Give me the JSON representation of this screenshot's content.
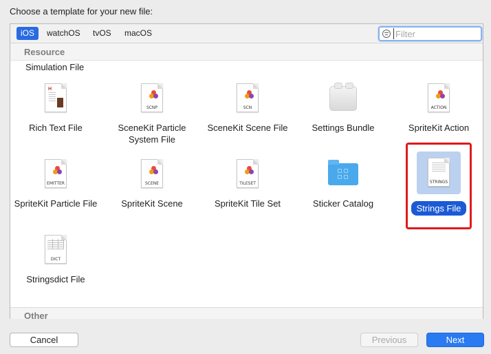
{
  "dialog": {
    "heading": "Choose a template for your new file:"
  },
  "platform_tabs": [
    {
      "label": "iOS",
      "selected": true
    },
    {
      "label": "watchOS",
      "selected": false
    },
    {
      "label": "tvOS",
      "selected": false
    },
    {
      "label": "macOS",
      "selected": false
    }
  ],
  "filter": {
    "placeholder": "Filter",
    "value": ""
  },
  "sections": {
    "resource": "Resource",
    "other": "Other"
  },
  "partial_item": "Simulation File",
  "templates": [
    {
      "label": "Rich Text File",
      "icon": "rich-text-file-icon",
      "caption": ""
    },
    {
      "label": "SceneKit Particle System File",
      "icon": "scenekit-particle-icon",
      "caption": "SCNP"
    },
    {
      "label": "SceneKit Scene File",
      "icon": "scenekit-scene-icon",
      "caption": "SCN"
    },
    {
      "label": "Settings Bundle",
      "icon": "settings-bundle-icon",
      "caption": ""
    },
    {
      "label": "SpriteKit Action",
      "icon": "spritekit-action-icon",
      "caption": "ACTION"
    },
    {
      "label": "SpriteKit Particle File",
      "icon": "spritekit-particle-icon",
      "caption": "EMITTER"
    },
    {
      "label": "SpriteKit Scene",
      "icon": "spritekit-scene-icon",
      "caption": "SCENE"
    },
    {
      "label": "SpriteKit Tile Set",
      "icon": "spritekit-tileset-icon",
      "caption": "TILESET"
    },
    {
      "label": "Sticker Catalog",
      "icon": "sticker-catalog-folder-icon",
      "caption": ""
    },
    {
      "label": "Strings File",
      "icon": "strings-file-icon",
      "caption": "STRINGS",
      "selected": true
    },
    {
      "label": "Stringsdict File",
      "icon": "stringsdict-file-icon",
      "caption": "DICT"
    }
  ],
  "buttons": {
    "cancel": "Cancel",
    "previous": "Previous",
    "next": "Next"
  },
  "colors": {
    "accent": "#2a7af2",
    "selection_label": "#1a5ad6",
    "annotation_red": "#e0191b"
  }
}
